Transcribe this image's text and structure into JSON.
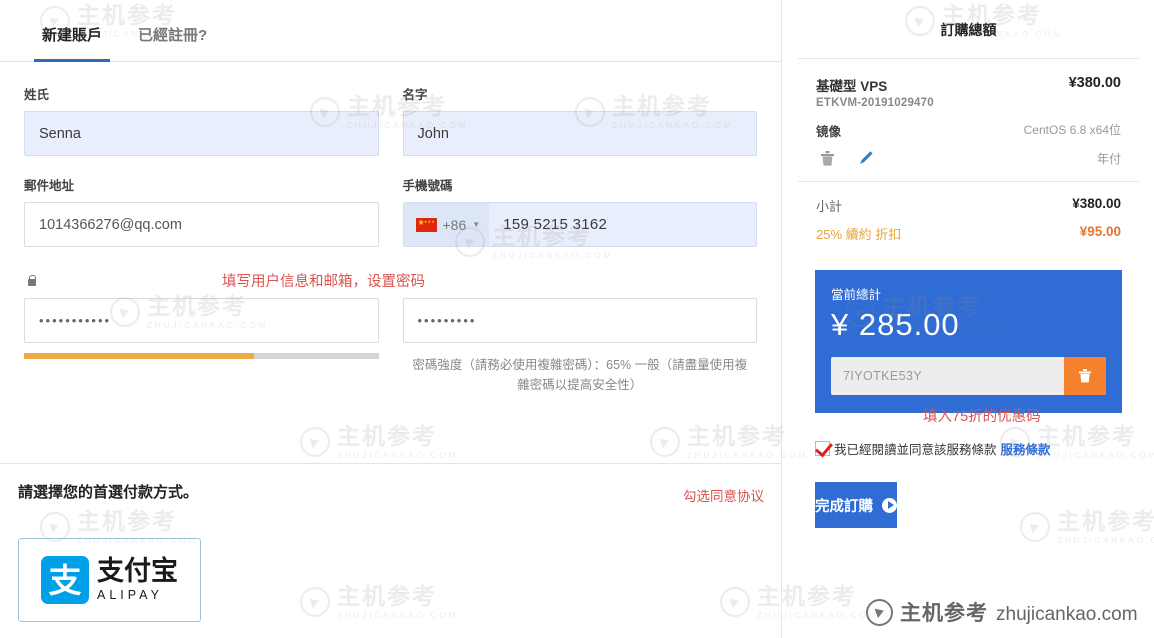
{
  "tabs": [
    {
      "label": "新建賬戶",
      "active": true
    },
    {
      "label": "已經註冊?",
      "active": false
    }
  ],
  "form": {
    "lastname_label": "姓氏",
    "lastname_value": "Senna",
    "firstname_label": "名字",
    "firstname_value": "John",
    "email_label": "郵件地址",
    "email_value": "1014366276@qq.com",
    "phone_label": "手機號碼",
    "phone_country_code": "+86",
    "phone_value": "159 5215 3162",
    "password_value": "•••••••••••",
    "password_confirm_value": "•••••••••",
    "strength_percent": 65,
    "strength_text": "密碼強度（請務必使用複雜密碼）：65% 一般（請盡量使用複雜密碼以提高安全性）"
  },
  "annotations": {
    "user_info": "填写用户信息和邮箱，设置密码",
    "promo": "填入75折的优惠码",
    "agree": "勾选同意协议"
  },
  "payment": {
    "title": "請選擇您的首選付款方式。",
    "option_cn": "支付宝",
    "option_en": "ALIPAY",
    "option_mark": "支"
  },
  "summary": {
    "title": "訂購總額",
    "product_name": "基礎型 VPS",
    "product_sku": "ETKVM-20191029470",
    "product_price": "¥380.00",
    "attr_key": "镜像",
    "attr_value": "CentOS 6.8 x64位",
    "billing_cycle": "年付",
    "subtotal_label": "小計",
    "subtotal_value": "¥380.00",
    "discount_label": "25% 續約 折扣",
    "discount_value": "¥95.00",
    "total_label": "當前總計",
    "total_value": "¥ 285.00",
    "promo_code": "7IYOTKE53Y",
    "agree_text": "我已經閱讀並同意該服務條款",
    "agree_link": "服務條款",
    "submit_label": "完成訂購"
  },
  "watermark": {
    "cn": "主机参考",
    "en": "ZHUJICANKAO.COM",
    "brand_cn": "主机参考",
    "brand_url": "zhujicankao.com"
  },
  "colors": {
    "accent_blue": "#2f6cd4",
    "tab_underline": "#2a6fb5",
    "discount_orange": "#e8742a",
    "strength_orange": "#efa943",
    "promo_delete": "#f5812f",
    "annotation_red": "#d9534f",
    "alipay_blue": "#00a0e9"
  }
}
